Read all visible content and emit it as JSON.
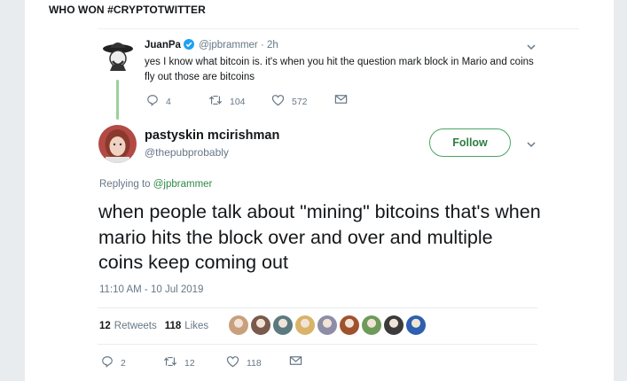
{
  "heading": "WHO WON #CRYPTOTWITTER",
  "parent_tweet": {
    "name": "JuanPa",
    "handle": "@jpbrammer",
    "separator": "·",
    "time": "2h",
    "text": "yes I know what bitcoin is. it's when you hit the question mark block in Mario and coins fly out those are bitcoins",
    "replies": "4",
    "retweets": "104",
    "likes": "572"
  },
  "main_tweet": {
    "name": "pastyskin mcirishman",
    "handle": "@thepubprobably",
    "follow_label": "Follow",
    "replying_label": "Replying to",
    "replying_handle": "@jpbrammer",
    "text": "when people talk about \"mining\" bitcoins that's when mario hits the block over and over and multiple coins keep coming out",
    "timestamp": "11:10 AM - 10 Jul 2019",
    "retweet_count": "12",
    "retweet_label": "Retweets",
    "like_count": "118",
    "like_label": "Likes",
    "replies": "2",
    "retweets": "12",
    "likes": "118"
  },
  "likers": [
    {
      "name": "liker-avatar-1",
      "color": "#c9a07c"
    },
    {
      "name": "liker-avatar-2",
      "color": "#7a5a4c"
    },
    {
      "name": "liker-avatar-3",
      "color": "#5b7a80"
    },
    {
      "name": "liker-avatar-4",
      "color": "#d9b36a"
    },
    {
      "name": "liker-avatar-5",
      "color": "#8d8da8"
    },
    {
      "name": "liker-avatar-6",
      "color": "#a0522d"
    },
    {
      "name": "liker-avatar-7",
      "color": "#6e9a5a"
    },
    {
      "name": "liker-avatar-8",
      "color": "#3b3b3b"
    },
    {
      "name": "liker-avatar-9",
      "color": "#2e5fb0"
    }
  ],
  "colors": {
    "accent_green": "#4aa564",
    "thread_line": "#9bd19b",
    "verified_blue": "#1da1f2",
    "muted_text": "#657786"
  },
  "icons": [
    "verified-icon",
    "chevron-down-icon",
    "reply-icon",
    "retweet-icon",
    "like-icon",
    "message-icon"
  ]
}
